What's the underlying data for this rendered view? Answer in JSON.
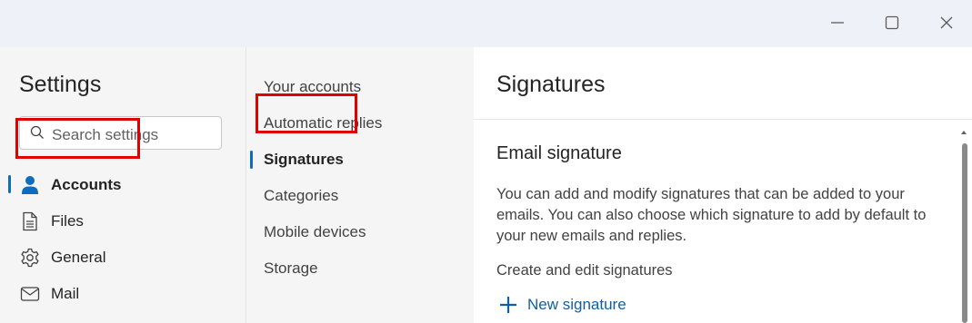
{
  "window": {
    "controls": [
      {
        "name": "minimize",
        "icon": "minimize-icon"
      },
      {
        "name": "maximize",
        "icon": "maximize-icon"
      },
      {
        "name": "close",
        "icon": "close-icon"
      }
    ]
  },
  "sidebar": {
    "title": "Settings",
    "search": {
      "placeholder": "Search settings",
      "value": ""
    },
    "items": [
      {
        "label": "Accounts",
        "icon": "person-icon",
        "active": true
      },
      {
        "label": "Files",
        "icon": "document-icon"
      },
      {
        "label": "General",
        "icon": "gear-icon"
      },
      {
        "label": "Mail",
        "icon": "mail-icon"
      }
    ]
  },
  "subnav": {
    "items": [
      {
        "label": "Your accounts"
      },
      {
        "label": "Automatic replies"
      },
      {
        "label": "Signatures",
        "active": true
      },
      {
        "label": "Categories"
      },
      {
        "label": "Mobile devices"
      },
      {
        "label": "Storage"
      }
    ]
  },
  "main": {
    "title": "Signatures",
    "section_title": "Email signature",
    "description": "You can add and modify signatures that can be added to your emails. You can also choose which signature to add by default to your new emails and replies.",
    "create_label": "Create and edit signatures",
    "new_signature_label": "New signature"
  },
  "colors": {
    "accent": "#0f6cbd",
    "highlight": "#e00000",
    "link": "#115ea3"
  }
}
